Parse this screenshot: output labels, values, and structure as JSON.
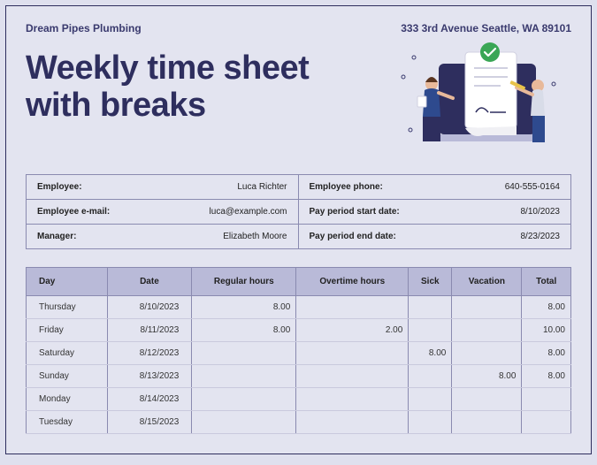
{
  "header": {
    "company": "Dream Pipes Plumbing",
    "address": "333 3rd Avenue Seattle, WA 89101"
  },
  "title_line1": "Weekly time sheet",
  "title_line2": "with breaks",
  "info": {
    "employee_label": "Employee:",
    "employee_value": "Luca Richter",
    "phone_label": "Employee phone:",
    "phone_value": "640-555-0164",
    "email_label": "Employee e-mail:",
    "email_value": "luca@example.com",
    "start_label": "Pay period start date:",
    "start_value": "8/10/2023",
    "manager_label": "Manager:",
    "manager_value": "Elizabeth Moore",
    "end_label": "Pay period end date:",
    "end_value": "8/23/2023"
  },
  "table": {
    "headers": {
      "day": "Day",
      "date": "Date",
      "regular": "Regular hours",
      "overtime": "Overtime hours",
      "sick": "Sick",
      "vacation": "Vacation",
      "total": "Total"
    },
    "rows": [
      {
        "day": "Thursday",
        "date": "8/10/2023",
        "regular": "8.00",
        "overtime": "",
        "sick": "",
        "vacation": "",
        "total": "8.00"
      },
      {
        "day": "Friday",
        "date": "8/11/2023",
        "regular": "8.00",
        "overtime": "2.00",
        "sick": "",
        "vacation": "",
        "total": "10.00"
      },
      {
        "day": "Saturday",
        "date": "8/12/2023",
        "regular": "",
        "overtime": "",
        "sick": "8.00",
        "vacation": "",
        "total": "8.00"
      },
      {
        "day": "Sunday",
        "date": "8/13/2023",
        "regular": "",
        "overtime": "",
        "sick": "",
        "vacation": "8.00",
        "total": "8.00"
      },
      {
        "day": "Monday",
        "date": "8/14/2023",
        "regular": "",
        "overtime": "",
        "sick": "",
        "vacation": "",
        "total": ""
      },
      {
        "day": "Tuesday",
        "date": "8/15/2023",
        "regular": "",
        "overtime": "",
        "sick": "",
        "vacation": "",
        "total": ""
      }
    ]
  }
}
